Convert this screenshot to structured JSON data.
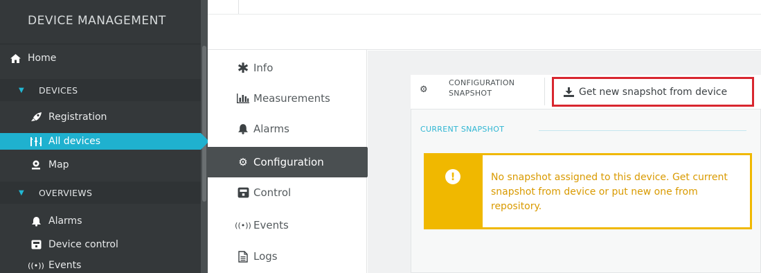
{
  "sidebar": {
    "brand": "DEVICE MANAGEMENT",
    "items": [
      {
        "label": "Home",
        "icon": "home-icon"
      },
      {
        "label": "DEVICES",
        "icon": "caret-down-icon"
      },
      {
        "label": "Registration",
        "icon": "rocket-icon"
      },
      {
        "label": "All devices",
        "icon": "devices-icon"
      },
      {
        "label": "Map",
        "icon": "map-marker-icon"
      },
      {
        "label": "OVERVIEWS",
        "icon": "caret-down-icon"
      },
      {
        "label": "Alarms",
        "icon": "bell-icon"
      },
      {
        "label": "Device control",
        "icon": "remote-control-icon"
      },
      {
        "label": "Events",
        "icon": "broadcast-icon"
      }
    ],
    "active_item": "All devices"
  },
  "device_tabs": [
    {
      "label": "Info",
      "icon": "asterisk-icon"
    },
    {
      "label": "Measurements",
      "icon": "bar-chart-icon"
    },
    {
      "label": "Alarms",
      "icon": "bell-icon"
    },
    {
      "label": "Configuration",
      "icon": "cogs-icon"
    },
    {
      "label": "Control",
      "icon": "remote-control-icon"
    },
    {
      "label": "Events",
      "icon": "broadcast-icon"
    },
    {
      "label": "Logs",
      "icon": "document-icon"
    }
  ],
  "active_tab": "Configuration",
  "configuration": {
    "tab_label": "CONFIGURATION SNAPSHOT",
    "get_button_label": "Get new snapshot from device",
    "section_heading": "CURRENT SNAPSHOT",
    "alert_text": "No snapshot assigned to this device. Get current snapshot from device or put new one from repository."
  },
  "colors": {
    "sidebar_bg": "#34383a",
    "accent": "#1fb1cf",
    "active_tab_bg": "#4a4f51",
    "warning": "#f0b800",
    "highlight_border": "#d8262f"
  }
}
